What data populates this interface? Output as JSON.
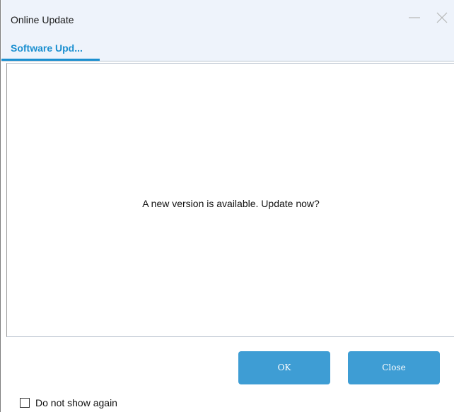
{
  "window": {
    "title": "Online Update"
  },
  "tabs": [
    {
      "label": "Software Upd...",
      "active": true
    }
  ],
  "dialog": {
    "message": "A new version is available. Update now?"
  },
  "buttons": {
    "ok_label": "OK",
    "close_label": "Close"
  },
  "checkbox": {
    "label": "Do not show again",
    "checked": false
  },
  "icons": {
    "minimize": "minimize-icon",
    "close": "close-icon"
  },
  "colors": {
    "accent": "#1a8fd0",
    "button_bg": "#3e9dd4",
    "titlebar_bg": "#eef3fb"
  }
}
